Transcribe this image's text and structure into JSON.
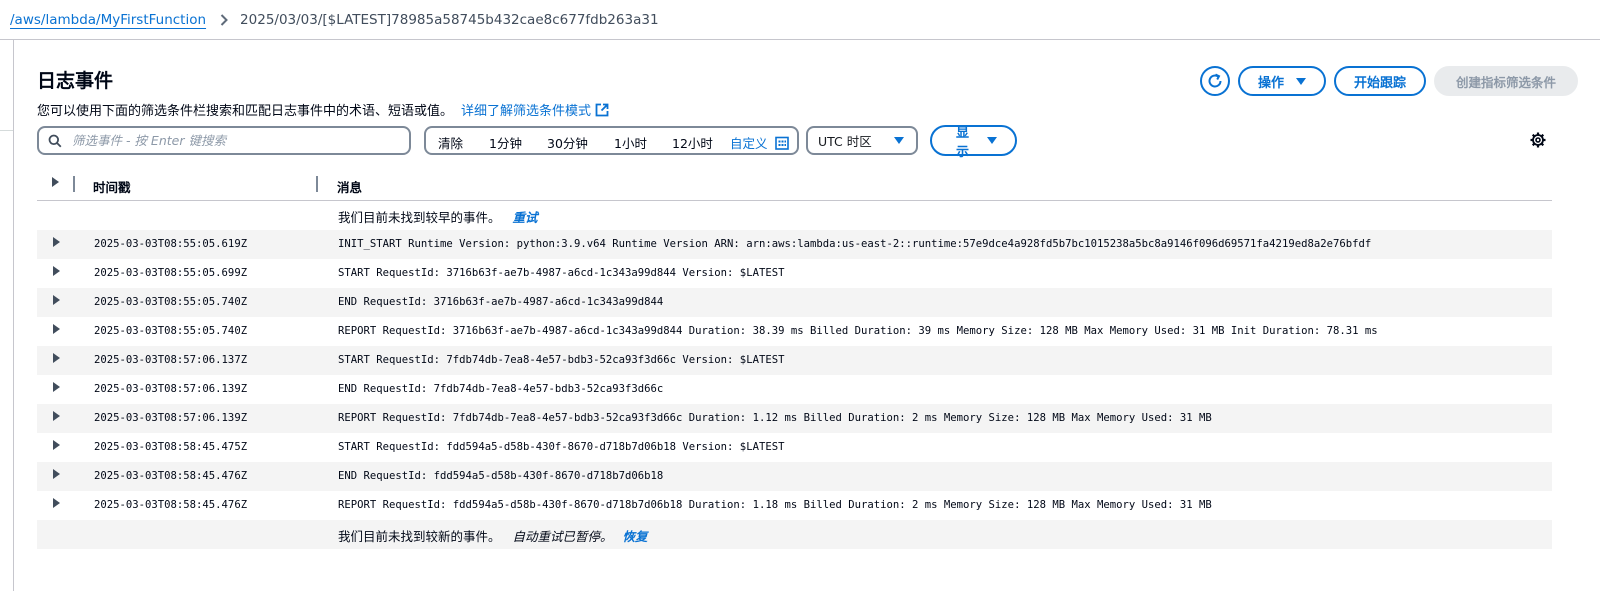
{
  "breadcrumb": {
    "log_group": "/aws/lambda/MyFirstFunction",
    "log_stream": "2025/03/03/[$LATEST]78985a58745b432cae8c677fdb263a31"
  },
  "header": {
    "title": "日志事件",
    "description": "您可以使用下面的筛选条件栏搜索和匹配日志事件中的术语、短语或值。",
    "learn_more_link": "详细了解筛选条件模式",
    "actions_label": "操作",
    "start_tail_label": "开始跟踪",
    "create_metric_filter_label": "创建指标筛选条件"
  },
  "filter": {
    "search_placeholder": "筛选事件 - 按 Enter 键搜索",
    "time_ranges": [
      "清除",
      "1分钟",
      "30分钟",
      "1小时",
      "12小时"
    ],
    "custom_label": "自定义",
    "timezone": "UTC 时区",
    "display_label": "显示"
  },
  "table": {
    "columns": {
      "timestamp": "时间戳",
      "message": "消息"
    },
    "top_note": {
      "text": "我们目前未找到较早的事件。",
      "retry": "重试"
    },
    "rows": [
      {
        "timestamp": "2025-03-03T08:55:05.619Z",
        "message": "INIT_START Runtime Version: python:3.9.v64 Runtime Version ARN: arn:aws:lambda:us-east-2::runtime:57e9dce4a928fd5b7bc1015238a5bc8a9146f096d69571fa4219ed8a2e76bfdf"
      },
      {
        "timestamp": "2025-03-03T08:55:05.699Z",
        "message": "START RequestId: 3716b63f-ae7b-4987-a6cd-1c343a99d844 Version: $LATEST"
      },
      {
        "timestamp": "2025-03-03T08:55:05.740Z",
        "message": "END RequestId: 3716b63f-ae7b-4987-a6cd-1c343a99d844"
      },
      {
        "timestamp": "2025-03-03T08:55:05.740Z",
        "message": "REPORT RequestId: 3716b63f-ae7b-4987-a6cd-1c343a99d844 Duration: 38.39 ms Billed Duration: 39 ms Memory Size: 128 MB Max Memory Used: 31 MB Init Duration: 78.31 ms"
      },
      {
        "timestamp": "2025-03-03T08:57:06.137Z",
        "message": "START RequestId: 7fdb74db-7ea8-4e57-bdb3-52ca93f3d66c Version: $LATEST"
      },
      {
        "timestamp": "2025-03-03T08:57:06.139Z",
        "message": "END RequestId: 7fdb74db-7ea8-4e57-bdb3-52ca93f3d66c"
      },
      {
        "timestamp": "2025-03-03T08:57:06.139Z",
        "message": "REPORT RequestId: 7fdb74db-7ea8-4e57-bdb3-52ca93f3d66c Duration: 1.12 ms Billed Duration: 2 ms Memory Size: 128 MB Max Memory Used: 31 MB"
      },
      {
        "timestamp": "2025-03-03T08:58:45.475Z",
        "message": "START RequestId: fdd594a5-d58b-430f-8670-d718b7d06b18 Version: $LATEST"
      },
      {
        "timestamp": "2025-03-03T08:58:45.476Z",
        "message": "END RequestId: fdd594a5-d58b-430f-8670-d718b7d06b18"
      },
      {
        "timestamp": "2025-03-03T08:58:45.476Z",
        "message": "REPORT RequestId: fdd594a5-d58b-430f-8670-d718b7d06b18 Duration: 1.18 ms Billed Duration: 2 ms Memory Size: 128 MB Max Memory Used: 31 MB"
      }
    ],
    "bottom_note": {
      "text": "我们目前未找到较新的事件。",
      "paused": "自动重试已暂停。",
      "resume": "恢复"
    }
  },
  "colors": {
    "link": "#0972d3",
    "row_shade": "#f4f4f4",
    "disabled_bg": "#e9ebed",
    "border": "#7d8998"
  },
  "icons": [
    "refresh-icon",
    "search-icon",
    "calendar-icon",
    "external-link-icon",
    "settings-icon",
    "chevron-right-icon",
    "caret-down-icon",
    "expand-caret-icon"
  ]
}
